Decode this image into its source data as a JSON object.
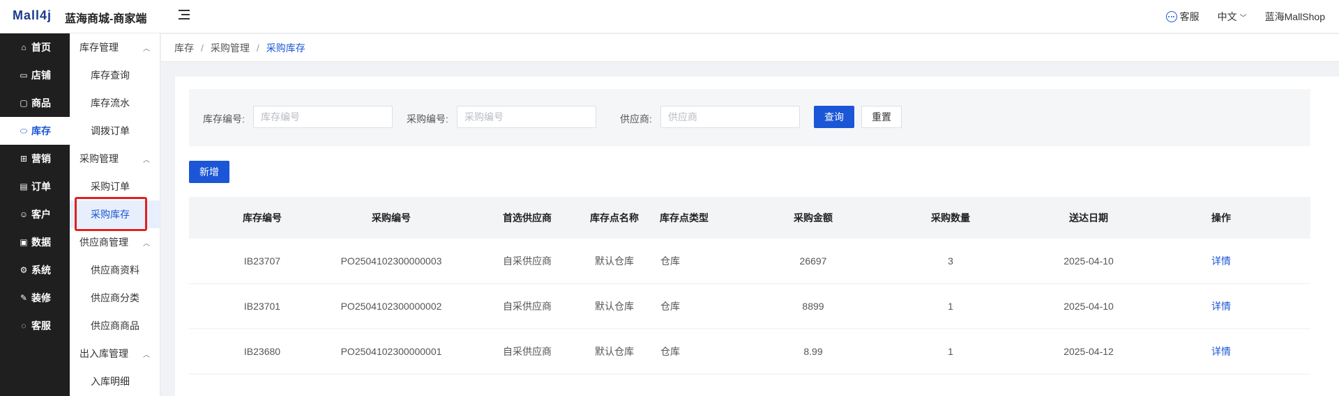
{
  "header": {
    "logo": "Mall4j",
    "title": "蓝海商城-商家端",
    "service_label": "客服",
    "language_label": "中文",
    "shop_name": "蓝海MallShop"
  },
  "main_nav": [
    {
      "label": "首页",
      "icon": "home-icon"
    },
    {
      "label": "店铺",
      "icon": "store-icon"
    },
    {
      "label": "商品",
      "icon": "product-icon"
    },
    {
      "label": "库存",
      "icon": "inventory-icon",
      "active": true
    },
    {
      "label": "营销",
      "icon": "gift-icon"
    },
    {
      "label": "订单",
      "icon": "order-icon"
    },
    {
      "label": "客户",
      "icon": "customer-icon"
    },
    {
      "label": "数据",
      "icon": "data-icon"
    },
    {
      "label": "系统",
      "icon": "settings-icon"
    },
    {
      "label": "装修",
      "icon": "decorate-icon"
    },
    {
      "label": "客服",
      "icon": "chat-icon"
    }
  ],
  "sub_nav": {
    "group1": "库存管理",
    "item1": "库存查询",
    "item2": "库存流水",
    "item3": "调拨订单",
    "group2": "采购管理",
    "item4": "采购订单",
    "item5": "采购库存",
    "group3": "供应商管理",
    "item6": "供应商资料",
    "item7": "供应商分类",
    "item8": "供应商商品",
    "group4": "出入库管理",
    "item9": "入库明细"
  },
  "breadcrumb": [
    "库存",
    "采购管理",
    "采购库存"
  ],
  "filter": {
    "stock_no_label": "库存编号:",
    "stock_no_placeholder": "库存编号",
    "purchase_no_label": "采购编号:",
    "purchase_no_placeholder": "采购编号",
    "supplier_label": "供应商:",
    "supplier_placeholder": "供应商",
    "query_button": "查询",
    "reset_button": "重置"
  },
  "add_button": "新增",
  "table": {
    "headers": [
      "库存编号",
      "采购编号",
      "首选供应商",
      "库存点名称",
      "库存点类型",
      "采购金额",
      "采购数量",
      "送达日期",
      "操作"
    ],
    "rows": [
      [
        "IB23707",
        "PO2504102300000003",
        "自采供应商",
        "默认仓库",
        "仓库",
        "26697",
        "3",
        "2025-04-10",
        "详情"
      ],
      [
        "IB23701",
        "PO2504102300000002",
        "自采供应商",
        "默认仓库",
        "仓库",
        "8899",
        "1",
        "2025-04-10",
        "详情"
      ],
      [
        "IB23680",
        "PO2504102300000001",
        "自采供应商",
        "默认仓库",
        "仓库",
        "8.99",
        "1",
        "2025-04-12",
        "详情"
      ]
    ]
  },
  "colors": {
    "primary": "#1a56d6",
    "sidebar_bg": "#1f1f1f",
    "highlight": "#e02020"
  }
}
